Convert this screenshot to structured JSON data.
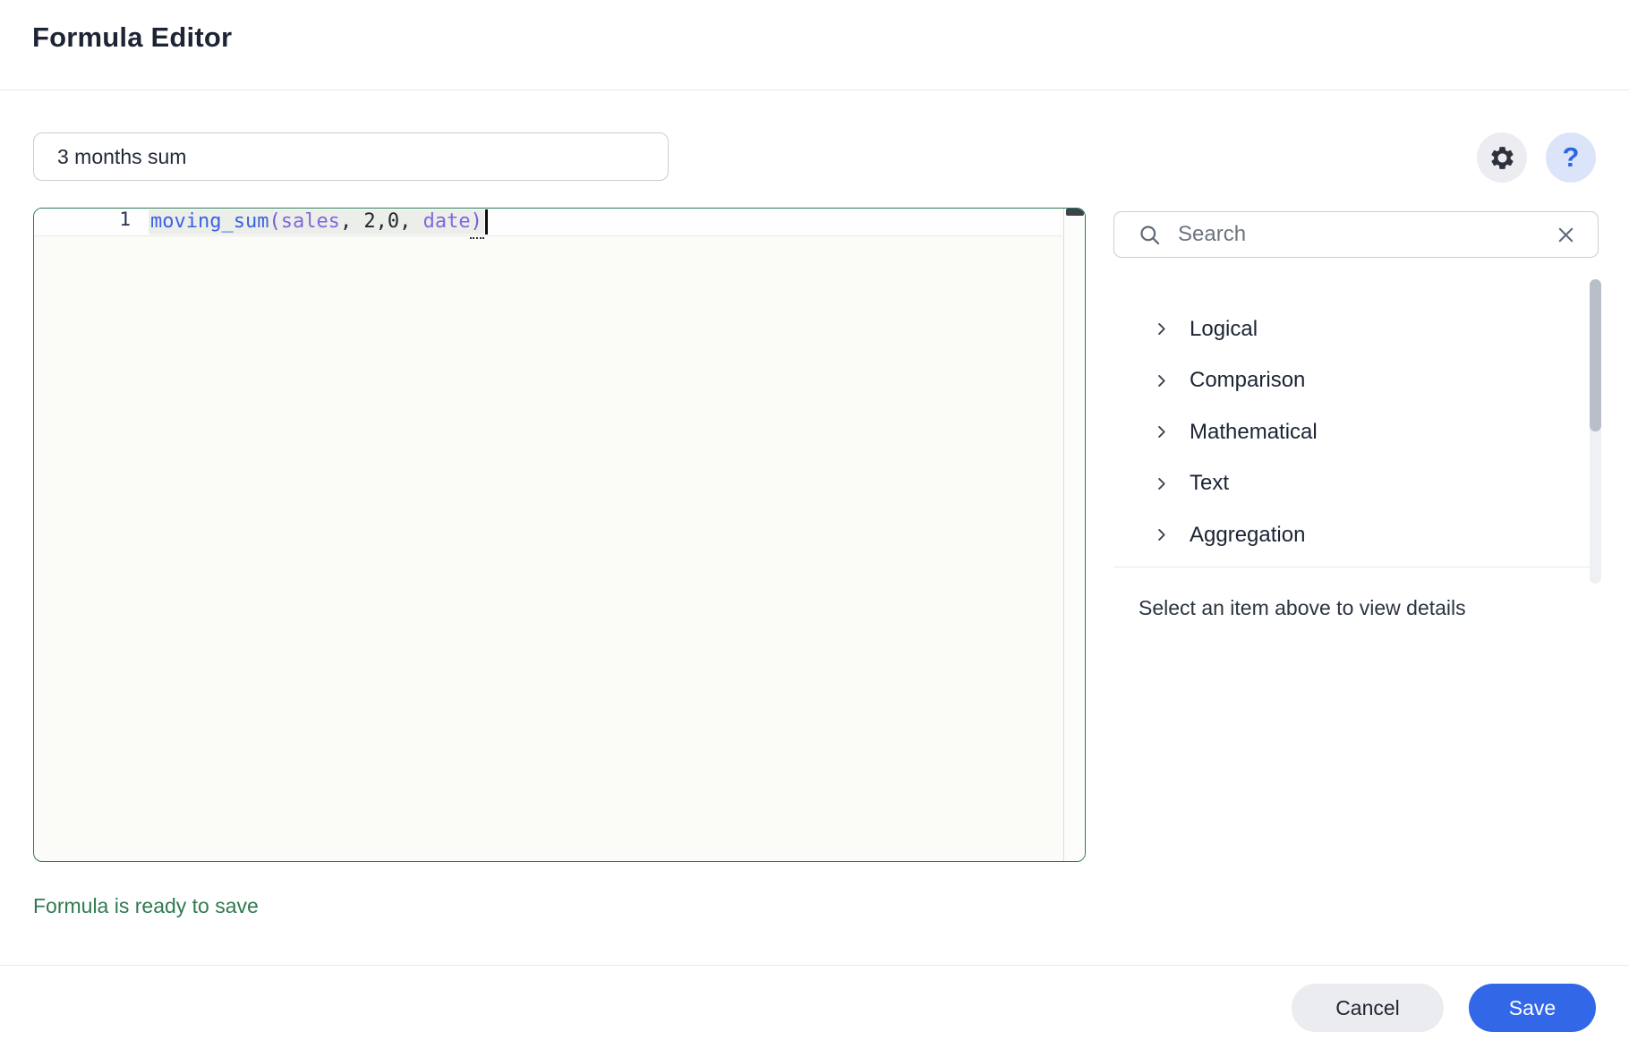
{
  "header": {
    "title": "Formula Editor"
  },
  "formula_name": {
    "value": "3 months sum"
  },
  "toolbar": {
    "help_label": "?"
  },
  "editor": {
    "line_number": "1",
    "formula_text": "moving_sum(sales, 2,0, date)",
    "tokens": [
      {
        "text": "moving_sum",
        "type": "function"
      },
      {
        "text": "(",
        "type": "operator"
      },
      {
        "text": "sales",
        "type": "column"
      },
      {
        "text": ", 2,0, ",
        "type": "plain"
      },
      {
        "text": "date",
        "type": "column"
      },
      {
        "text": ")",
        "type": "operator"
      }
    ],
    "status": "Formula is ready to save"
  },
  "panel": {
    "search": {
      "placeholder": "Search",
      "value": ""
    },
    "categories": [
      "Logical",
      "Comparison",
      "Mathematical",
      "Text",
      "Aggregation"
    ],
    "hint": "Select an item above to view details"
  },
  "footer": {
    "cancel_label": "Cancel",
    "save_label": "Save"
  },
  "colors": {
    "accent_blue": "#3267E8",
    "success_green": "#2F7A50",
    "editor_border_green": "#2E7A55",
    "token_function": "#3A62E4",
    "token_column": "#8168DC",
    "token_operator": "#7C56D6",
    "token_plain": "#23272E",
    "help_circle": "#DCE4F9",
    "settings_circle": "#ECEDF1"
  }
}
